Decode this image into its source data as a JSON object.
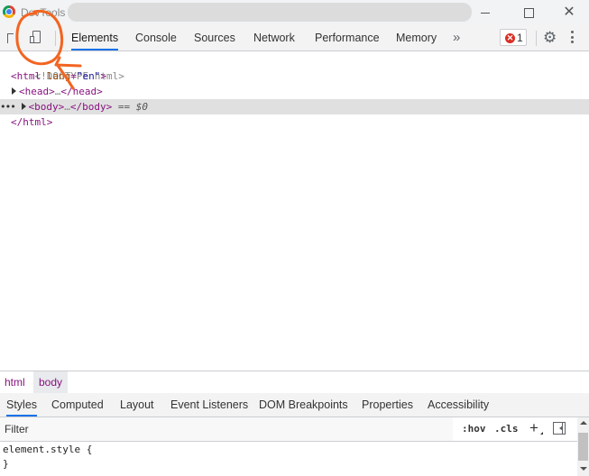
{
  "window": {
    "title": "DevTools",
    "controls": {
      "minimize": "",
      "maximize": "",
      "close": "✕"
    }
  },
  "toolbar": {
    "tabs": [
      "Elements",
      "Console",
      "Sources",
      "Network",
      "Performance",
      "Memory"
    ],
    "active_tab": "Elements",
    "more_tabs_glyph": "»",
    "error_count": "1",
    "error_glyph": "✕",
    "settings_glyph": "⚙"
  },
  "dom": {
    "lines": [
      {
        "text_open": "<!DOCTYPE html>"
      },
      {
        "tag_open": "<html",
        "attr_name": "lang",
        "attr_eq": "=",
        "attr_val": "\"en\"",
        "tag_close": ">"
      },
      {
        "tag": "<head>",
        "ellipsis": "…",
        "tag_end": "</head>"
      },
      {
        "dots": "•••",
        "tag": "<body>",
        "ellipsis": "…",
        "tag_end": "</body>",
        "marker": "== $0"
      },
      {
        "tag": "</html>"
      }
    ]
  },
  "breadcrumbs": [
    "html",
    "body"
  ],
  "subtabs": [
    "Styles",
    "Computed",
    "Layout",
    "Event Listeners",
    "DOM Breakpoints",
    "Properties",
    "Accessibility"
  ],
  "active_subtab": "Styles",
  "filter": {
    "placeholder": "Filter"
  },
  "filter_tools": {
    "hov": ":hov",
    "cls": ".cls",
    "plus": "+"
  },
  "styles": {
    "selector_line": "element.style {",
    "close_line": "}"
  },
  "annotation": {
    "color": "#f26522"
  },
  "colors": {
    "accent": "#1a73e8",
    "tag": "#881280",
    "error": "#d93025"
  }
}
